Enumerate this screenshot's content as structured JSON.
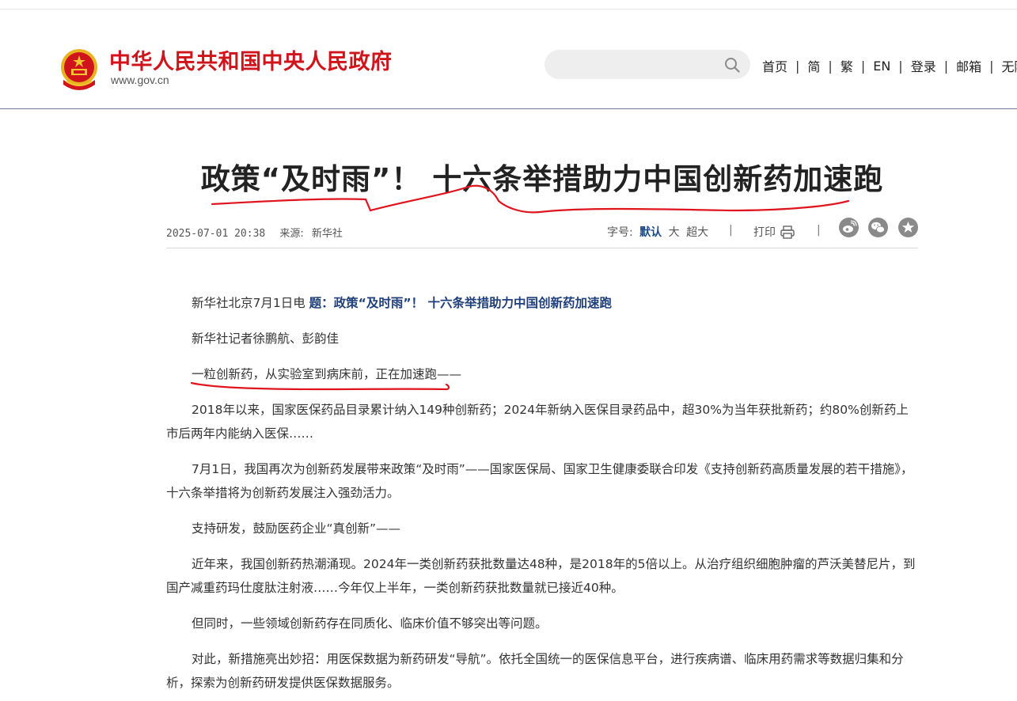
{
  "header": {
    "site_title": "中华人民共和国中央人民政府",
    "site_url": "www.gov.cn",
    "search": {
      "placeholder": ""
    },
    "nav": [
      "首页",
      "简",
      "繁",
      "EN",
      "登录",
      "邮箱",
      "无障碍"
    ]
  },
  "article": {
    "title": "政策“及时雨”！ 十六条举措助力中国创新药加速跑",
    "date": "2025-07-01 20:38",
    "source_label": "来源:",
    "source": "新华社",
    "font_size_label": "字号:",
    "font_sizes": [
      "默认",
      "大",
      "超大"
    ],
    "print_label": "打印",
    "dateline": "新华社北京7月1日电",
    "subtitle": "题：政策“及时雨”！ 十六条举措助力中国创新药加速跑",
    "paragraphs": [
      "新华社记者徐鹏航、彭韵佳",
      "一粒创新药，从实验室到病床前，正在加速跑——",
      "2018年以来，国家医保药品目录累计纳入149种创新药；2024年新纳入医保目录药品中，超30%为当年获批新药；约80%创新药上市后两年内能纳入医保……",
      "7月1日，我国再次为创新药发展带来政策“及时雨”——国家医保局、国家卫生健康委联合印发《支持创新药高质量发展的若干措施》，十六条举措将为创新药发展注入强劲活力。",
      "支持研发，鼓励医药企业“真创新”——",
      "近年来，我国创新药热潮涌现。2024年一类创新药获批数量达48种，是2018年的5倍以上。从治疗组织细胞肿瘤的芦沃美替尼片，到国产减重药玛仕度肽注射液……今年仅上半年，一类创新药获批数量就已接近40种。",
      "但同时，一些领域创新药存在同质化、临床价值不够突出等问题。",
      "对此，新措施亮出妙招：用医保数据为新药研发“导航”。依托全国统一的医保信息平台，进行疾病谱、临床用药需求等数据归集和分析，探索为创新药研发提供医保数据服务。"
    ]
  },
  "colors": {
    "brand_red": "#d0141c",
    "subtitle_blue": "#1f3f7a",
    "active_font_size": "#1d4a86",
    "annotation_red": "#e0141c"
  },
  "icons": [
    "national-emblem-icon",
    "search-icon",
    "printer-icon",
    "weibo-icon",
    "wechat-icon",
    "favorite-star-icon"
  ]
}
